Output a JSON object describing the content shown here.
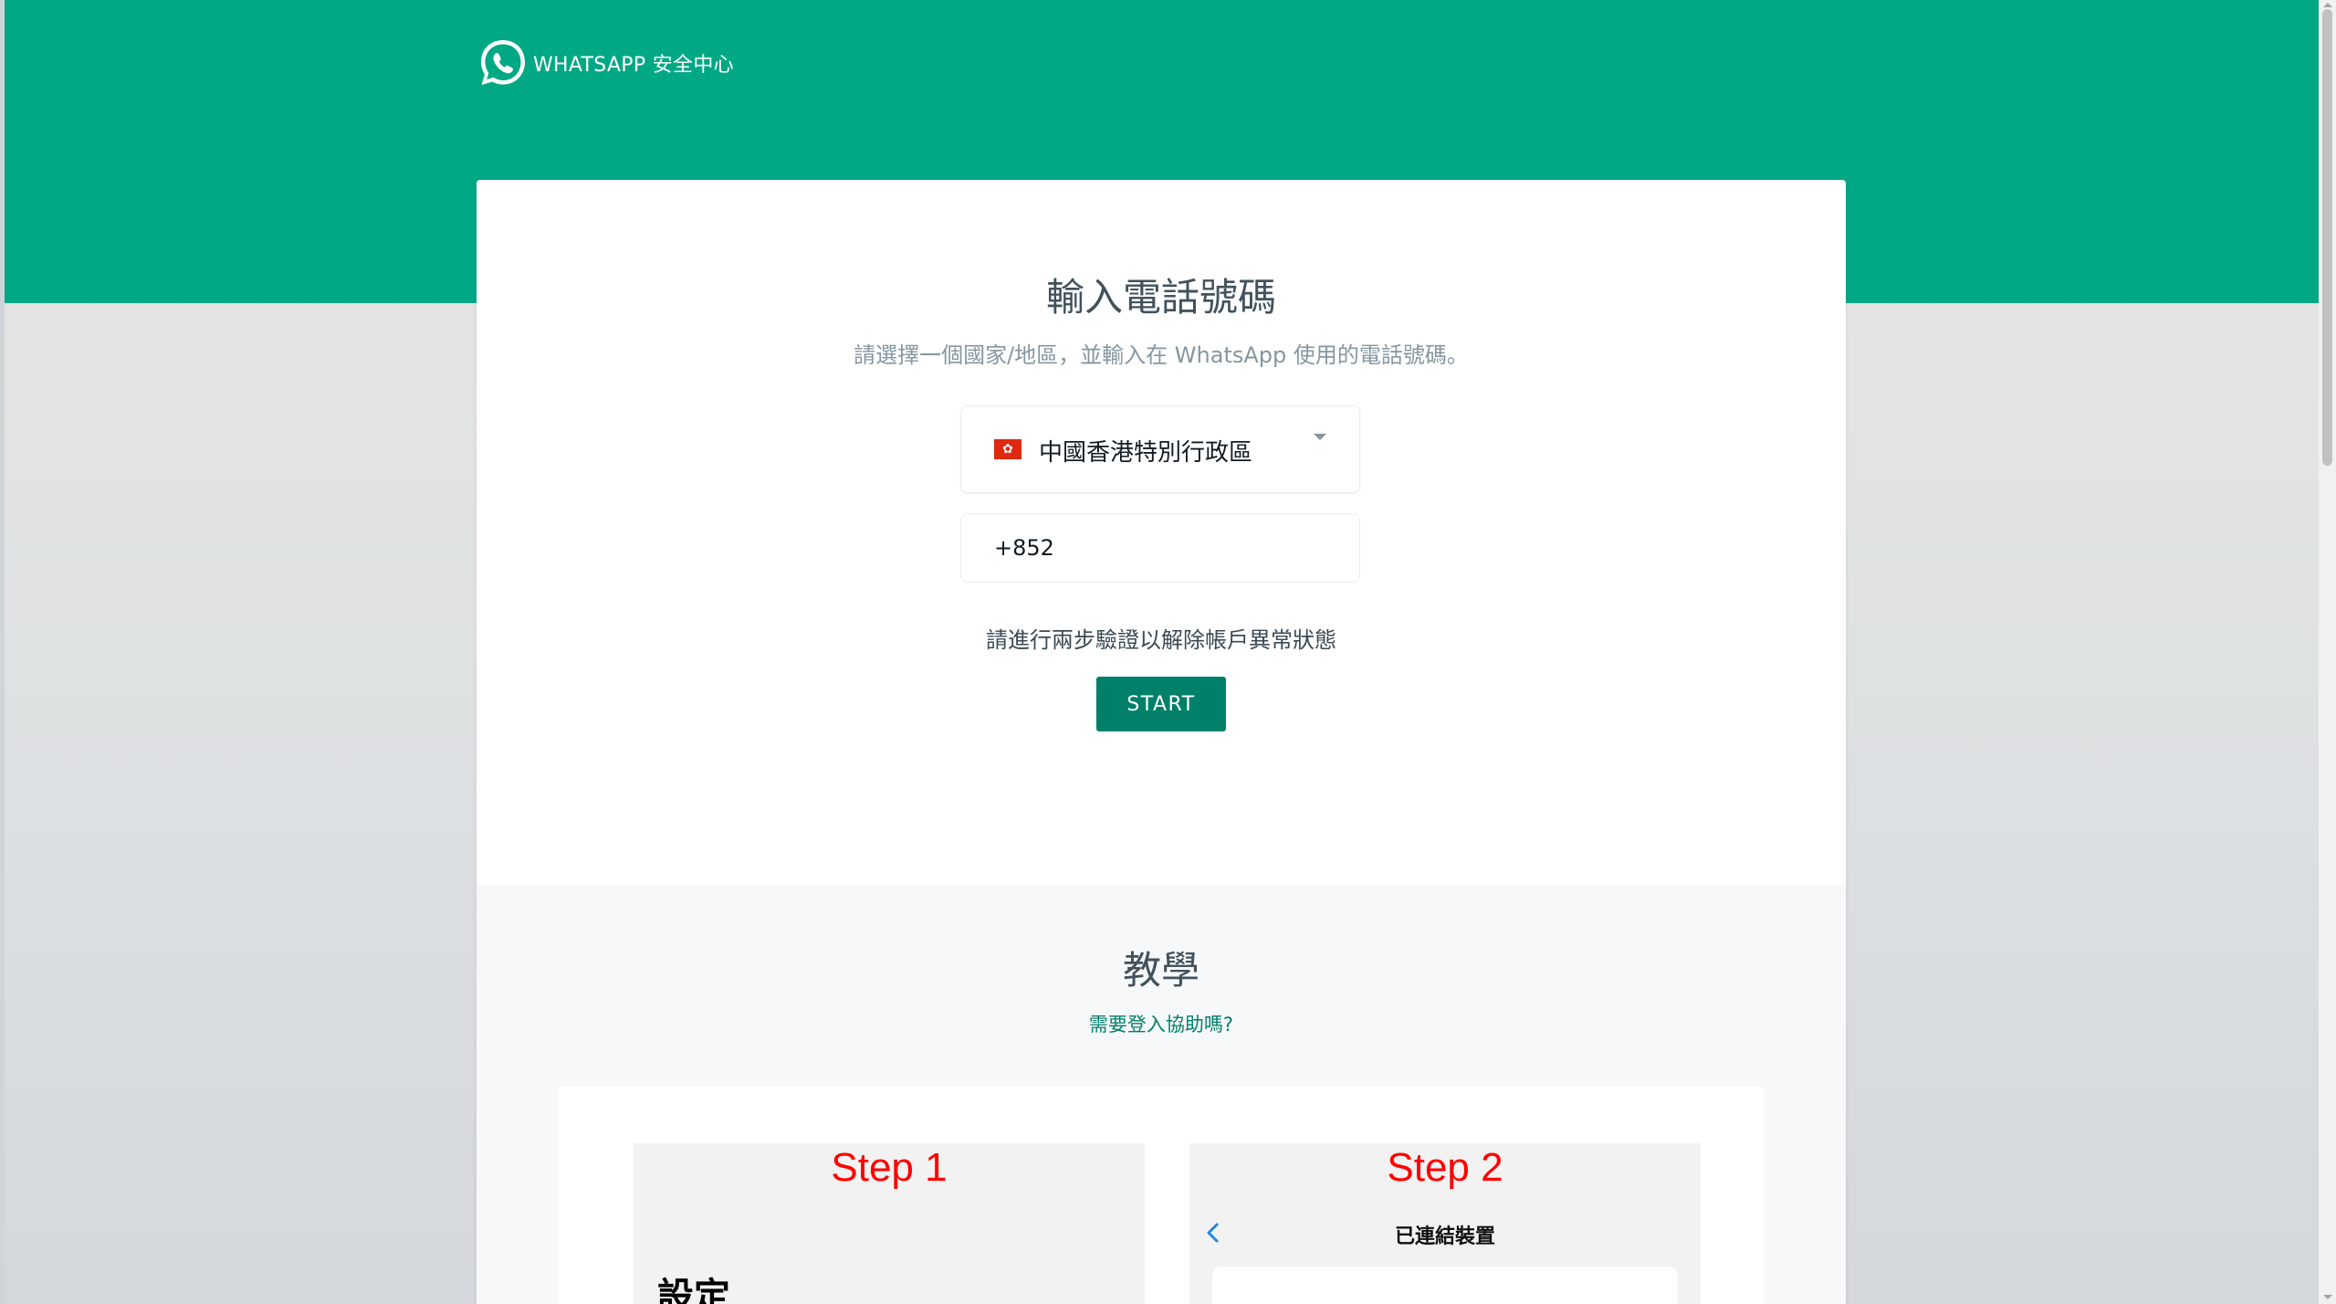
{
  "brand": {
    "name": "WHATSAPP 安全中心",
    "logo_icon": "whatsapp-logo-icon",
    "primary_color": "#00a884",
    "accent_color": "#008069"
  },
  "form": {
    "title": "輸入電話號碼",
    "subtitle": "請選擇一個國家/地區，並輸入在 WhatsApp 使用的電話號碼。",
    "country": {
      "flag_icon": "hong-kong-flag-icon",
      "selected": "中國香港特別行政區"
    },
    "phone": {
      "value": "+852"
    },
    "verify_text": "請進行兩步驗證以解除帳戶異常狀態",
    "start_label": "START"
  },
  "tutorial": {
    "title": "教學",
    "help_link": "需要登入協助嗎?",
    "steps": [
      {
        "label": "Step 1",
        "heading": "設定"
      },
      {
        "label": "Step 2",
        "back_icon": "chevron-left-icon",
        "title": "已連結裝置"
      }
    ]
  }
}
